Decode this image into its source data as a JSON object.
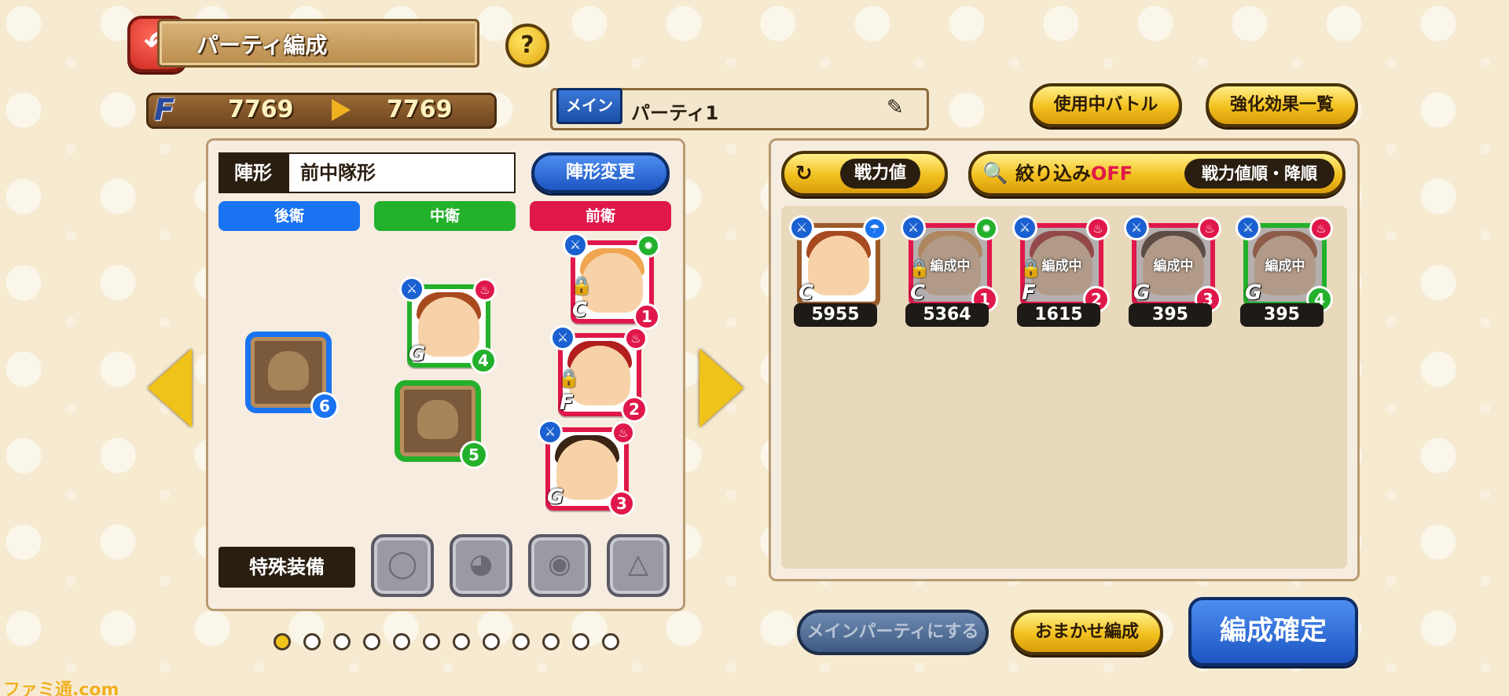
{
  "header": {
    "title": "パーティ編成",
    "help": "?"
  },
  "f_bar": {
    "letter": "F",
    "current": "7769",
    "next": "7769"
  },
  "party": {
    "tag": "メイン",
    "name": "パーティ1"
  },
  "top_buttons": {
    "battle_in_use": "使用中バトル",
    "enhance_list": "強化効果一覧"
  },
  "formation": {
    "label": "陣形",
    "value": "前中隊形",
    "change_button": "陣形変更",
    "rows": {
      "back": "後衛",
      "middle": "中衛",
      "front": "前衛"
    }
  },
  "slots": [
    {
      "num": "1",
      "rank": "C"
    },
    {
      "num": "2",
      "rank": "F"
    },
    {
      "num": "3",
      "rank": "G"
    },
    {
      "num": "4",
      "rank": "G"
    },
    {
      "num": "5"
    },
    {
      "num": "6"
    }
  ],
  "special_equipment": {
    "label": "特殊装備"
  },
  "list_header": {
    "sort_by": "戦力値",
    "filter_prefix": "絞り込み",
    "filter_state": "OFF",
    "sort_order": "戦力値順・降順"
  },
  "roster": [
    {
      "power": "5955",
      "rank": "C",
      "status": ""
    },
    {
      "power": "5364",
      "rank": "C",
      "status": "編成中",
      "num": "1"
    },
    {
      "power": "1615",
      "rank": "F",
      "status": "編成中",
      "num": "2"
    },
    {
      "power": "395",
      "rank": "G",
      "status": "編成中",
      "num": "3"
    },
    {
      "power": "395",
      "rank": "G",
      "status": "編成中",
      "num": "4"
    }
  ],
  "bottom_buttons": {
    "set_main": "メインパーティにする",
    "auto": "おまかせ編成",
    "confirm": "編成確定"
  },
  "pagination": {
    "total": 12,
    "current": 1
  },
  "watermark": "ファミ通.com",
  "colors": {
    "accent_gold": "#f0c31a",
    "back_row": "#1a73f0",
    "middle_row": "#23b02b",
    "front_row": "#e0174a"
  }
}
